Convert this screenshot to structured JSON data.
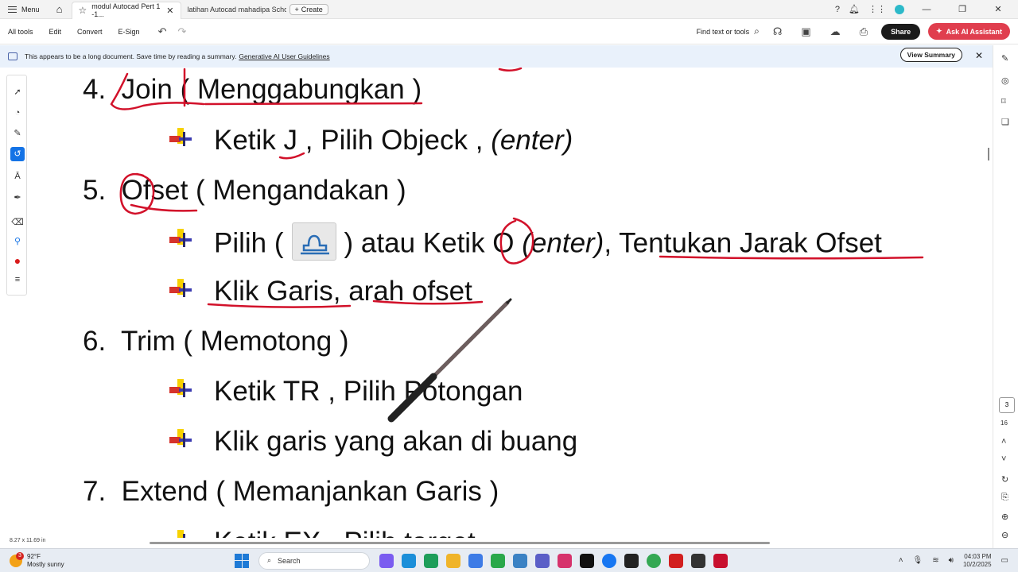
{
  "tabbar": {
    "menu_label": "Menu",
    "tabs": [
      {
        "label": "modul Autocad Pert 1 -1..."
      },
      {
        "label": "latihan Autocad mahadipa Scho..."
      }
    ],
    "create_label": "Create"
  },
  "toolbar": {
    "items": [
      "All tools",
      "Edit",
      "Convert",
      "E-Sign"
    ],
    "find_label": "Find text or tools",
    "share_label": "Share",
    "ai_label": "Ask AI Assistant"
  },
  "banner": {
    "text": "This appears to be a long document. Save time by reading a summary.",
    "link": "Generative AI User Guidelines",
    "button": "View Summary"
  },
  "document": {
    "item4_num": "4.",
    "item4_title": "Join",
    "item4_rest": "( Menggabungkan )",
    "item4_b1_a": "Ketik ",
    "item4_b1_key": "J",
    "item4_b1_b": " , Pilih Objeck , ",
    "item4_b1_enter": "(enter)",
    "item5_num": "5.",
    "item5_title": "Ofset",
    "item5_rest": "( Mengandakan )",
    "item5_b1_a": "Pilih (",
    "item5_b1_b": ") atau Ketik ",
    "item5_b1_key": "O",
    "item5_b1_enter": " (enter)",
    "item5_b1_c": ", Tentukan Jarak Ofset",
    "item5_b2": "Klik Garis, arah ofset",
    "item6_num": "6.",
    "item6_title": "Trim ( Memotong )",
    "item6_b1": "Ketik TR , Pilih Potongan",
    "item6_b2": "Klik garis yang akan di buang",
    "item7_num": "7.",
    "item7_title": "Extend ( Memanjankan Garis )",
    "item7_b1": "Ketik EX , Pilih target"
  },
  "status": {
    "page_size": "8.27 x 11.69 in",
    "current_page": "3",
    "total_pages": "16"
  },
  "taskbar": {
    "weather_badge": "3",
    "temperature": "92°F",
    "condition": "Mostly sunny",
    "search_label": "Search",
    "time": "04:03 PM",
    "date": "10/2/2025"
  },
  "colors": {
    "ink_red": "#d2112a",
    "accent_blue": "#1473e6",
    "ai_button": "#e03e4e"
  }
}
